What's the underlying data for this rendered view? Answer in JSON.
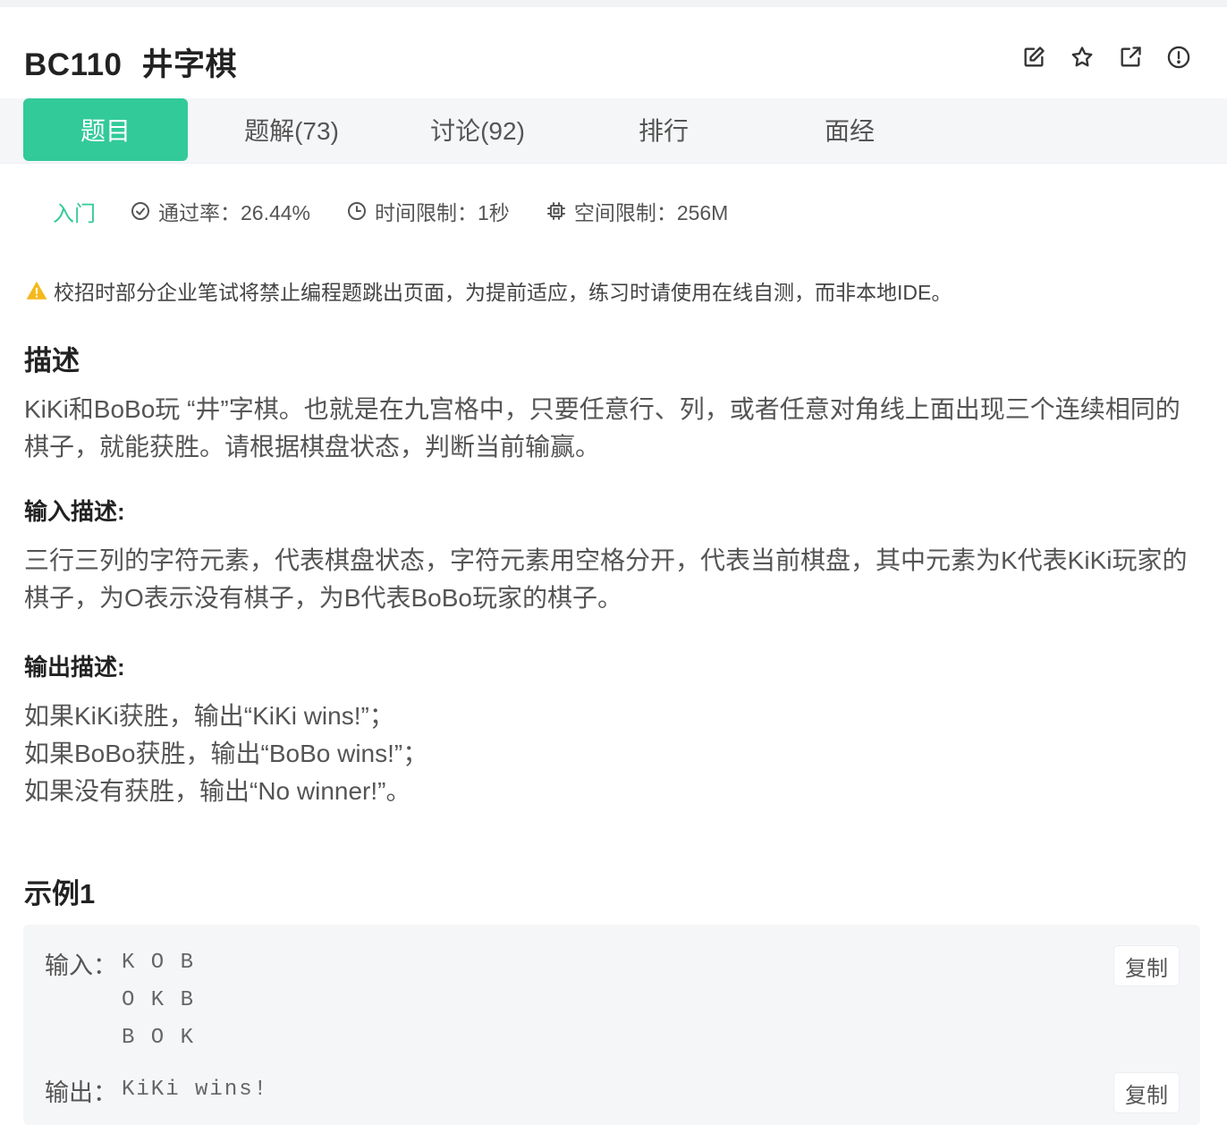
{
  "header": {
    "problem_id": "BC110",
    "problem_title": "井字棋",
    "icons": [
      "edit-icon",
      "star-icon",
      "share-icon",
      "report-icon"
    ]
  },
  "tabs": [
    {
      "label": "题目",
      "active": true
    },
    {
      "label": "题解(73)",
      "active": false
    },
    {
      "label": "讨论(92)",
      "active": false
    },
    {
      "label": "排行",
      "active": false
    },
    {
      "label": "面经",
      "active": false
    }
  ],
  "meta": {
    "difficulty": "入门",
    "pass_rate": "通过率：26.44%",
    "time_limit": "时间限制：1秒",
    "memory_limit": "空间限制：256M"
  },
  "warning": "校招时部分企业笔试将禁止编程题跳出页面，为提前适应，练习时请使用在线自测，而非本地IDE。",
  "description": {
    "heading": "描述",
    "text": "KiKi和BoBo玩 “井”字棋。也就是在九宫格中，只要任意行、列，或者任意对角线上面出现三个连续相同的棋子，就能获胜。请根据棋盘状态，判断当前输赢。"
  },
  "input_desc": {
    "heading": "输入描述:",
    "text": "三行三列的字符元素，代表棋盘状态，字符元素用空格分开，代表当前棋盘，其中元素为K代表KiKi玩家的棋子，为O表示没有棋子，为B代表BoBo玩家的棋子。"
  },
  "output_desc": {
    "heading": "输出描述:",
    "lines": [
      "如果KiKi获胜，输出“KiKi wins!”；",
      "如果BoBo获胜，输出“BoBo wins!”；",
      "如果没有获胜，输出“No winner!”。"
    ]
  },
  "example": {
    "heading": "示例1",
    "input_label": "输入：",
    "input_value": "K O B\nO K B\nB O K",
    "output_label": "输出：",
    "output_value": "KiKi wins!",
    "copy_label": "复制"
  },
  "colors": {
    "accent": "#32ca99",
    "warning": "#f5b81c",
    "tabs_bg": "#f5f6f8"
  }
}
